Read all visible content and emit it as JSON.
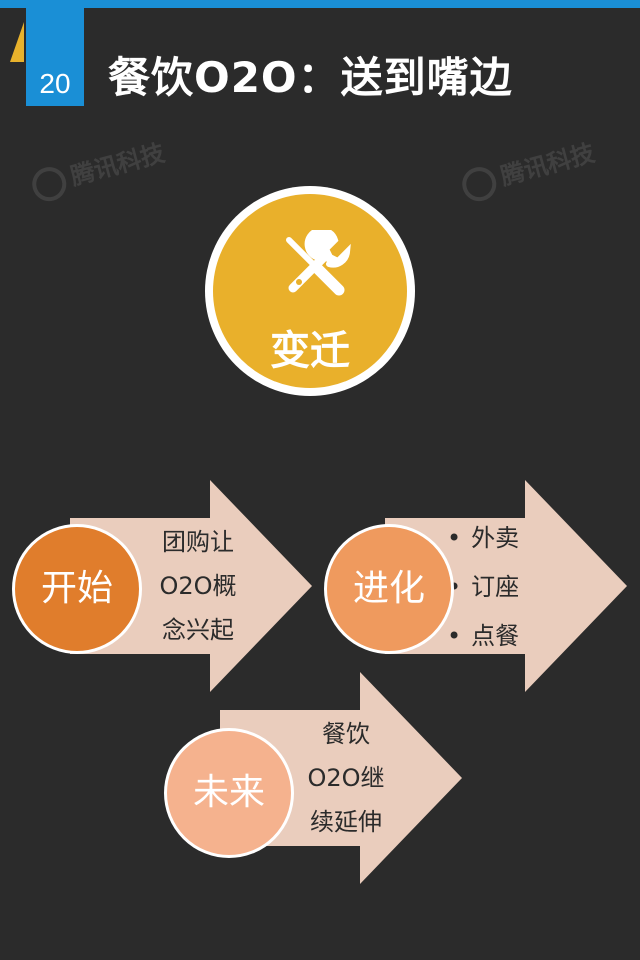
{
  "header": {
    "page_number": "20",
    "title": "餐饮O2O：送到嘴边"
  },
  "watermark": {
    "text": "腾讯科技"
  },
  "center": {
    "label": "变迁",
    "icon": "tools-icon"
  },
  "stages": [
    {
      "label": "开始",
      "text": [
        "团购让",
        "O2O概",
        "念兴起"
      ],
      "color": "#e07d2c"
    },
    {
      "label": "进化",
      "bullets": [
        "外卖",
        "订座",
        "点餐"
      ],
      "color": "#ef9a5e"
    },
    {
      "label": "未来",
      "text": [
        "餐饮",
        "O2O继",
        "续延伸"
      ],
      "color": "#f5b28e"
    }
  ],
  "colors": {
    "background": "#2b2b2b",
    "accent_blue": "#1a8fd6",
    "accent_gold": "#e9b02b",
    "arrow_fill": "#eacdbd"
  }
}
